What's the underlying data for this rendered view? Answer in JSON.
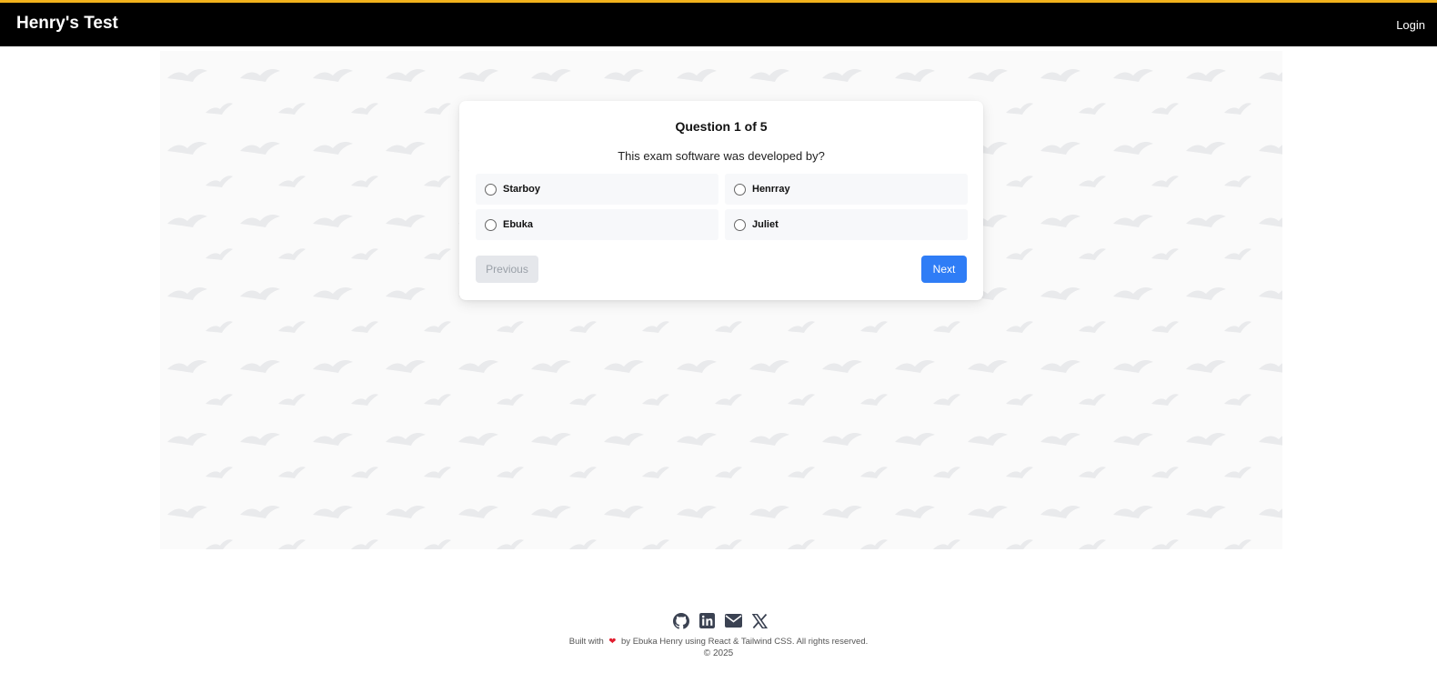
{
  "header": {
    "brand": "Henry's Test",
    "login_label": "Login"
  },
  "quiz": {
    "title": "Question 1 of 5",
    "question": "This exam software was developed by?",
    "options": [
      {
        "label": "Starboy"
      },
      {
        "label": "Henrray"
      },
      {
        "label": "Ebuka"
      },
      {
        "label": "Juliet"
      }
    ],
    "previous_label": "Previous",
    "next_label": "Next"
  },
  "footer": {
    "icons": [
      "github-icon",
      "linkedin-icon",
      "mail-icon",
      "x-icon"
    ],
    "built_prefix": "Built with",
    "built_suffix": "by Ebuka Henry using React & Tailwind CSS. All rights reserved.",
    "copyright": "© 2025"
  },
  "colors": {
    "accent": "#2f7df6",
    "topbar_border": "#f2b21c",
    "topbar": "#000000",
    "heart": "#e11d2e"
  }
}
